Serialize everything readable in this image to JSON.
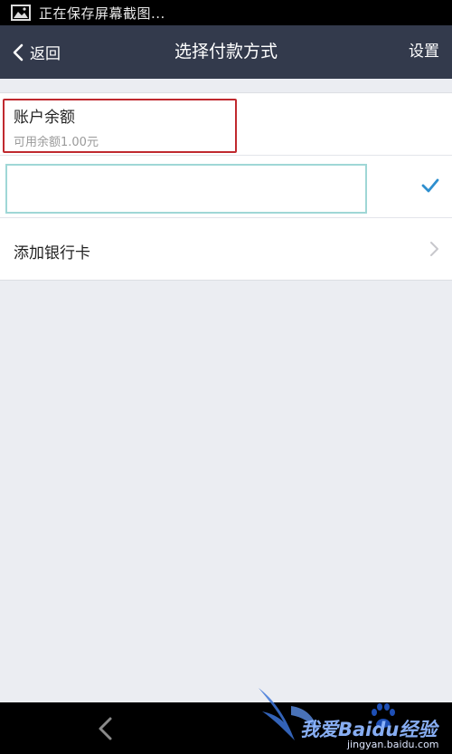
{
  "status_bar": {
    "text": "正在保存屏幕截图...",
    "icon": "image-icon"
  },
  "nav": {
    "back_label": "返回",
    "title": "选择付款方式",
    "settings_label": "设置"
  },
  "payment_methods": {
    "balance": {
      "title": "账户余额",
      "subtitle": "可用余额1.00元"
    },
    "selected": {
      "icon": "checkmark-icon"
    },
    "add_card": {
      "label": "添加银行卡",
      "icon": "chevron-right-icon"
    }
  },
  "colors": {
    "nav_bg": "#333a4c",
    "check": "#2e8fcf",
    "highlight": "#c0292f",
    "selected_border": "#9fd7d6"
  },
  "watermark": {
    "text": "我爱Baidu经验",
    "url": "jingyan.baidu.com"
  }
}
